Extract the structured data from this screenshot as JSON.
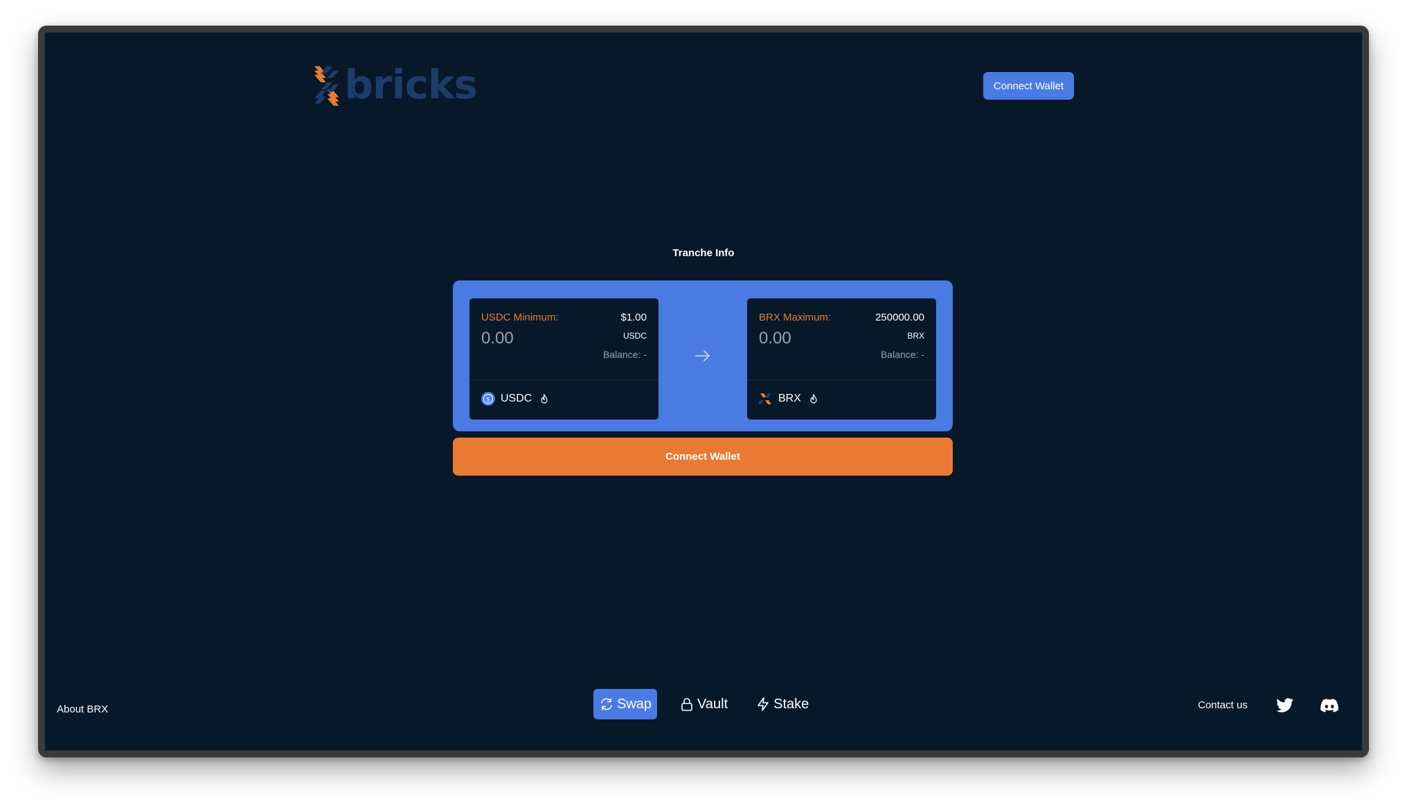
{
  "header": {
    "brand": "bricks",
    "connect_wallet_label": "Connect Wallet"
  },
  "tranche": {
    "title": "Tranche Info",
    "from": {
      "label": "USDC Minimum:",
      "amount_value": "$1.00",
      "unit": "USDC",
      "placeholder": "0.00",
      "balance": "Balance: -",
      "token": "USDC",
      "icon": "usdc-coin-icon"
    },
    "to": {
      "label": "BRX Maximum:",
      "amount_value": "250000.00",
      "unit": "BRX",
      "placeholder": "0.00",
      "balance": "Balance: -",
      "token": "BRX",
      "icon": "brx-logo-icon"
    },
    "action_label": "Connect Wallet"
  },
  "footer": {
    "about_label": "About BRX",
    "nav": [
      {
        "label": "Swap",
        "icon": "refresh-icon",
        "active": true
      },
      {
        "label": "Vault",
        "icon": "lock-icon",
        "active": false
      },
      {
        "label": "Stake",
        "icon": "lightning-icon",
        "active": false
      }
    ],
    "contact_label": "Contact us",
    "social": [
      "twitter-icon",
      "discord-icon"
    ]
  },
  "colors": {
    "background": "#071828",
    "accent_blue": "#4a7be3",
    "accent_orange": "#e87a33",
    "muted_text": "#9aa3ad"
  }
}
